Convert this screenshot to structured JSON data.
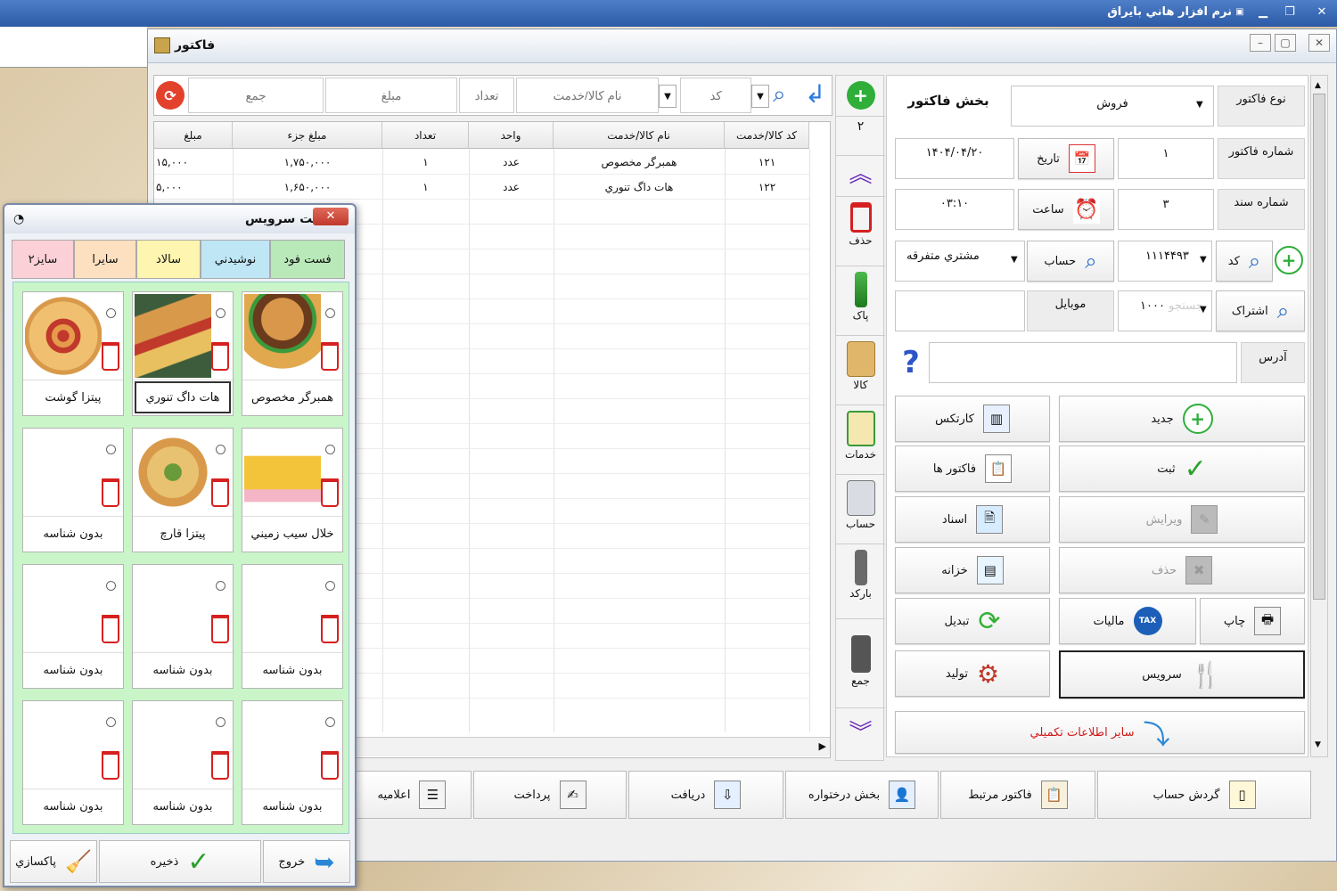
{
  "app_title": "نرم افزار هاني بايراق",
  "window": {
    "title": "فاکتور"
  },
  "header": {
    "section_title": "بخش فاکتور",
    "invoice_type_label": "نوع فاکتور",
    "invoice_type_value": "فروش",
    "invoice_number_label": "شماره فاکتور",
    "invoice_number_value": "۱",
    "date_label": "تاريخ",
    "date_value": "۱۴۰۴/۰۴/۲۰",
    "doc_number_label": "شماره سند",
    "doc_number_value": "۳",
    "time_label": "ساعت",
    "time_value": "۰۳:۱۰",
    "code_label": "کد",
    "code_value": "۱۱۱۴۴۹۳",
    "account_label": "حساب",
    "customer_value": "مشتري متفرقه",
    "subscription_label": "اشتراک",
    "subscription_value": "۱۰۰۰",
    "subscription_placeholder": "جستجو",
    "mobile_label": "موبايل",
    "address_label": "آدرس",
    "help_symbol": "?"
  },
  "actions": [
    {
      "name": "new",
      "label": "جديد"
    },
    {
      "name": "cardex",
      "label": "کارتکس"
    },
    {
      "name": "save",
      "label": "ثبت"
    },
    {
      "name": "invoices",
      "label": "فاکتور ها"
    },
    {
      "name": "edit",
      "label": "ويرايش"
    },
    {
      "name": "documents",
      "label": "اسناد"
    },
    {
      "name": "delete",
      "label": "حذف"
    },
    {
      "name": "treasury",
      "label": "خزانه"
    },
    {
      "name": "print",
      "label": "چاپ"
    },
    {
      "name": "tax",
      "label": "ماليات"
    },
    {
      "name": "convert",
      "label": "تبديل"
    },
    {
      "name": "service",
      "label": "سرويس"
    },
    {
      "name": "production",
      "label": "توليد"
    },
    {
      "name": "more_info",
      "label": "ساير اطلاعات تکميلي"
    }
  ],
  "entry": {
    "code_placeholder": "کد",
    "name_placeholder": "نام کالا/خدمت",
    "qty_placeholder": "تعداد",
    "price_placeholder": "مبلغ",
    "total_placeholder": "جمع"
  },
  "grid": {
    "headers": [
      "کد کالا/خدمت",
      "نام کالا/خدمت",
      "واحد",
      "تعداد",
      "مبلغ جزء",
      "مبلغ"
    ],
    "rows": [
      [
        "۱۲۱",
        "همبرگر مخصوص",
        "عدد",
        "۱",
        "۱,۷۵۰,۰۰۰",
        "۱۵,۰۰۰"
      ],
      [
        "۱۲۲",
        "هات داگ تنوري",
        "عدد",
        "۱",
        "۱,۶۵۰,۰۰۰",
        "۵,۰۰۰"
      ]
    ]
  },
  "toolbar": {
    "count": "۲",
    "items": [
      "حذف",
      "پاک",
      "کالا",
      "خدمات",
      "حساب",
      "بارکد",
      "جمع"
    ]
  },
  "bottom": [
    "گردش حساب",
    "فاکتور مرتبط",
    "بخش درختواره",
    "دريافت",
    "پرداخت",
    "اعلاميه"
  ],
  "popup": {
    "title": "ليست سرويس",
    "tabs": [
      "فست فود",
      "نوشيدني",
      "سالاد",
      "سايرا",
      "سايز۲"
    ],
    "cards": [
      {
        "name": "همبرگر مخصوص",
        "icon": "burger"
      },
      {
        "name": "هات داگ تنوري",
        "icon": "hotdog"
      },
      {
        "name": "پيتزا گوشت",
        "icon": "pizza"
      },
      {
        "name": "خلال سيب زميني",
        "icon": "fries"
      },
      {
        "name": "پيتزا قارچ",
        "icon": "pizza2"
      },
      {
        "name": "بدون شناسه",
        "icon": ""
      },
      {
        "name": "بدون شناسه",
        "icon": ""
      },
      {
        "name": "بدون شناسه",
        "icon": ""
      },
      {
        "name": "بدون شناسه",
        "icon": ""
      },
      {
        "name": "بدون شناسه",
        "icon": ""
      },
      {
        "name": "بدون شناسه",
        "icon": ""
      },
      {
        "name": "بدون شناسه",
        "icon": ""
      }
    ],
    "exit_label": "خروج",
    "save_label": "ذخيره",
    "clear_label": "پاکسازي"
  }
}
